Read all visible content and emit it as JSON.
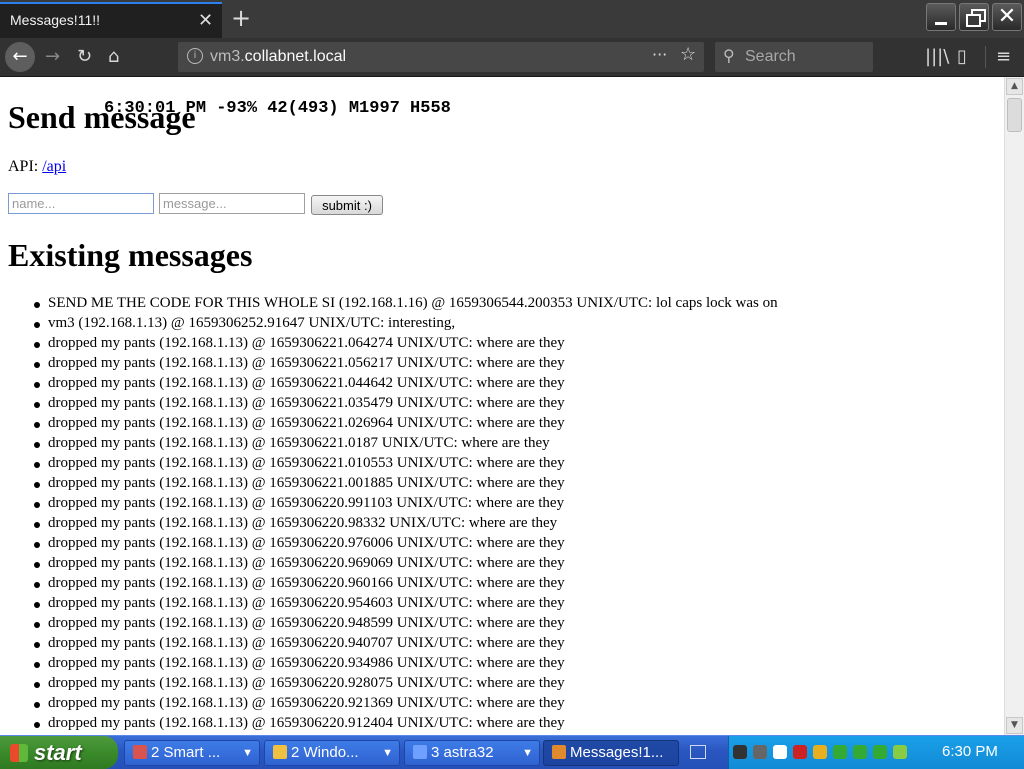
{
  "tab": {
    "title": "Messages!11!!",
    "close": "✕",
    "new_tab": "+"
  },
  "window": {
    "close_glyph": "✕"
  },
  "nav": {
    "back": "←",
    "forward": "→",
    "reload": "↻",
    "home": "⌂",
    "url_prefix": "vm3.",
    "url_host": "collabnet.local",
    "info": "i",
    "page_actions": "···",
    "bookmark": "☆",
    "search_placeholder": "Search",
    "search_icon": "⚲",
    "library_icon": "|||\\",
    "sidebar_icon": "▯",
    "menu_icon": "≡"
  },
  "page": {
    "send_title": "Send message",
    "overlay_stats": "6:30:01 PM -93% 42(493) M1997 H558",
    "api_label": "API: ",
    "api_link": "/api",
    "name_placeholder": "name...",
    "message_placeholder": "message...",
    "submit_label": "submit :)",
    "existing_title": "Existing messages",
    "messages": [
      "SEND ME THE CODE FOR THIS WHOLE SI (192.168.1.16) @ 1659306544.200353 UNIX/UTC: lol caps lock was on",
      "vm3 (192.168.1.13) @ 1659306252.91647 UNIX/UTC: interesting,",
      "dropped my pants (192.168.1.13) @ 1659306221.064274 UNIX/UTC: where are they",
      "dropped my pants (192.168.1.13) @ 1659306221.056217 UNIX/UTC: where are they",
      "dropped my pants (192.168.1.13) @ 1659306221.044642 UNIX/UTC: where are they",
      "dropped my pants (192.168.1.13) @ 1659306221.035479 UNIX/UTC: where are they",
      "dropped my pants (192.168.1.13) @ 1659306221.026964 UNIX/UTC: where are they",
      "dropped my pants (192.168.1.13) @ 1659306221.0187 UNIX/UTC: where are they",
      "dropped my pants (192.168.1.13) @ 1659306221.010553 UNIX/UTC: where are they",
      "dropped my pants (192.168.1.13) @ 1659306221.001885 UNIX/UTC: where are they",
      "dropped my pants (192.168.1.13) @ 1659306220.991103 UNIX/UTC: where are they",
      "dropped my pants (192.168.1.13) @ 1659306220.98332 UNIX/UTC: where are they",
      "dropped my pants (192.168.1.13) @ 1659306220.976006 UNIX/UTC: where are they",
      "dropped my pants (192.168.1.13) @ 1659306220.969069 UNIX/UTC: where are they",
      "dropped my pants (192.168.1.13) @ 1659306220.960166 UNIX/UTC: where are they",
      "dropped my pants (192.168.1.13) @ 1659306220.954603 UNIX/UTC: where are they",
      "dropped my pants (192.168.1.13) @ 1659306220.948599 UNIX/UTC: where are they",
      "dropped my pants (192.168.1.13) @ 1659306220.940707 UNIX/UTC: where are they",
      "dropped my pants (192.168.1.13) @ 1659306220.934986 UNIX/UTC: where are they",
      "dropped my pants (192.168.1.13) @ 1659306220.928075 UNIX/UTC: where are they",
      "dropped my pants (192.168.1.13) @ 1659306220.921369 UNIX/UTC: where are they",
      "dropped my pants (192.168.1.13) @ 1659306220.912404 UNIX/UTC: where are they"
    ]
  },
  "scrollbar": {
    "up": "▲",
    "down": "▼"
  },
  "taskbar": {
    "start_label": "start",
    "tasks": [
      {
        "count": "2",
        "label": "Smart ...",
        "caret": "▼",
        "color": "#d9534f"
      },
      {
        "count": "2",
        "label": "Windo...",
        "caret": "▼",
        "color": "#f0c040"
      },
      {
        "count": "3",
        "label": "astra32",
        "caret": "▼",
        "color": "#6fa0ff"
      },
      {
        "count": "",
        "label": "Messages!1...",
        "caret": "",
        "color": "#e08a2e"
      }
    ],
    "tray_colors": [
      "#333333",
      "#666666",
      "#ffffff",
      "#cc2222",
      "#e8b020",
      "#33aa33",
      "#33aa33",
      "#33aa33",
      "#88cc44"
    ],
    "clock": "6:30 PM"
  },
  "colors": {
    "accent": "#2d7ff0",
    "link": "#0000ee",
    "taskbar": "#2a56c0",
    "start": "#3a8a2a"
  }
}
